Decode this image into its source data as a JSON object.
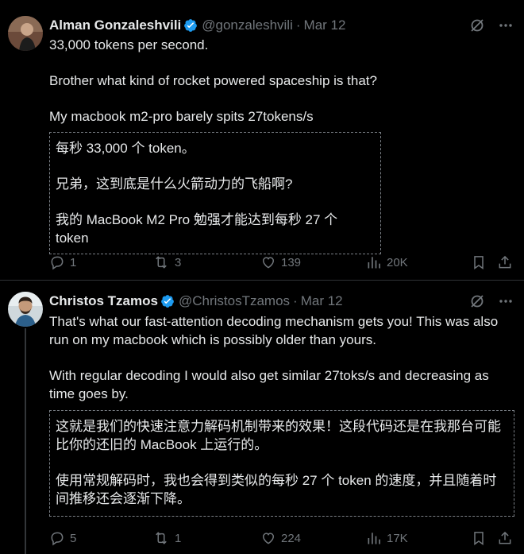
{
  "tweets": [
    {
      "name": "Alman Gonzaleshvili",
      "handle": "@gonzaleshvili",
      "separator": "·",
      "date": "Mar 12",
      "body": [
        "33,000 tokens per second.",
        "Brother what kind of rocket powered spaceship is that?",
        "My macbook m2-pro barely spits 27tokens/s"
      ],
      "translation": [
        "每秒 33,000 个 token。",
        "兄弟，这到底是什么火箭动力的飞船啊?",
        "我的 MacBook M2 Pro 勉强才能达到每秒 27 个 token"
      ],
      "stats": {
        "replies": "1",
        "reposts": "3",
        "likes": "139",
        "views": "20K"
      }
    },
    {
      "name": "Christos Tzamos",
      "handle": "@ChristosTzamos",
      "separator": "·",
      "date": "Mar 12",
      "body": [
        "That's what our fast-attention decoding mechanism gets you! This was also run on my macbook which is possibly older than yours.",
        "With regular decoding I would also get similar 27toks/s and decreasing as time goes by."
      ],
      "translation": [
        "这就是我们的快速注意力解码机制带来的效果！这段代码还是在我那台可能比你的还旧的 MacBook 上运行的。",
        "使用常规解码时，我也会得到类似的每秒 27 个 token 的速度，并且随着时间推移还会逐渐下降。"
      ],
      "stats": {
        "replies": "5",
        "reposts": "1",
        "likes": "224",
        "views": "17K"
      }
    }
  ],
  "colors": {
    "background": "#000000",
    "text": "#e7e9ea",
    "muted": "#71767b",
    "verified": "#1d9bf0",
    "divider": "#2f3336"
  },
  "icons": [
    "verified-badge-icon",
    "grok-icon",
    "more-icon",
    "reply-icon",
    "repost-icon",
    "like-icon",
    "views-icon",
    "bookmark-icon",
    "share-icon"
  ]
}
